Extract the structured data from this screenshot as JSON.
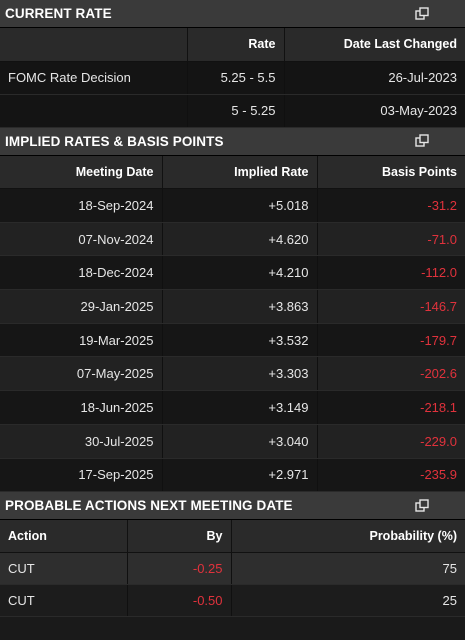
{
  "current_rate": {
    "title": "CURRENT RATE",
    "columns": [
      "",
      "Rate",
      "Date Last Changed"
    ],
    "rows": [
      {
        "label": "FOMC Rate Decision",
        "rate": "5.25 - 5.5",
        "date": "26-Jul-2023"
      },
      {
        "label": "",
        "rate": "5 - 5.25",
        "date": "03-May-2023"
      }
    ]
  },
  "implied": {
    "title": "IMPLIED RATES & BASIS POINTS",
    "columns": [
      "Meeting Date",
      "Implied Rate",
      "Basis Points"
    ],
    "rows": [
      {
        "date": "18-Sep-2024",
        "rate": "+5.018",
        "bp": "-31.2"
      },
      {
        "date": "07-Nov-2024",
        "rate": "+4.620",
        "bp": "-71.0"
      },
      {
        "date": "18-Dec-2024",
        "rate": "+4.210",
        "bp": "-112.0"
      },
      {
        "date": "29-Jan-2025",
        "rate": "+3.863",
        "bp": "-146.7"
      },
      {
        "date": "19-Mar-2025",
        "rate": "+3.532",
        "bp": "-179.7"
      },
      {
        "date": "07-May-2025",
        "rate": "+3.303",
        "bp": "-202.6"
      },
      {
        "date": "18-Jun-2025",
        "rate": "+3.149",
        "bp": "-218.1"
      },
      {
        "date": "30-Jul-2025",
        "rate": "+3.040",
        "bp": "-229.0"
      },
      {
        "date": "17-Sep-2025",
        "rate": "+2.971",
        "bp": "-235.9"
      }
    ]
  },
  "actions": {
    "title": "PROBABLE ACTIONS NEXT MEETING DATE",
    "columns": [
      "Action",
      "By",
      "Probability (%)"
    ],
    "rows": [
      {
        "action": "CUT",
        "by": "-0.25",
        "prob": "75"
      },
      {
        "action": "CUT",
        "by": "-0.50",
        "prob": "25"
      }
    ]
  },
  "colors": {
    "negative": "#e0323c",
    "header_bg": "#3a3a3a",
    "column_header_bg": "#2a2a2a",
    "background": "#1a1a1a"
  },
  "icons": {
    "popout": "popout-icon"
  }
}
